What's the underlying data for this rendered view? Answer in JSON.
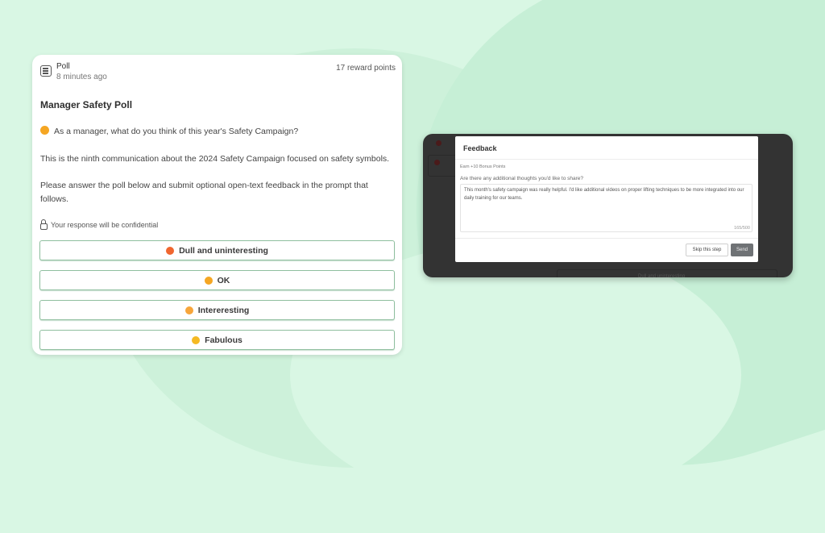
{
  "poll_card": {
    "type_label": "Poll",
    "time_ago": "8 minutes ago",
    "reward": "17 reward points",
    "title": "Manager Safety Poll",
    "question": "As a manager, what do you think of this year's Safety Campaign?",
    "body_1": "This is the ninth communication about the 2024 Safety Campaign focused on safety symbols.",
    "body_2": "Please answer the poll below and submit optional open-text feedback in the prompt that follows.",
    "confidential": "Your response will be confidential",
    "options": [
      {
        "label": "Dull and uninteresting",
        "emoji": "face-with-open-mouth-emoji",
        "color": "#f0662f"
      },
      {
        "label": "OK",
        "emoji": "tired-face-emoji",
        "color": "#f5a623"
      },
      {
        "label": "Intereresting",
        "emoji": "grinning-face-emoji",
        "color": "#f7a53b"
      },
      {
        "label": "Fabulous",
        "emoji": "raising-hands-emoji",
        "color": "#f5b923"
      }
    ]
  },
  "feedback_modal": {
    "title": "Feedback",
    "bonus": "Earn +10 Bonus Points",
    "question": "Are there any additional thoughts you'd like to share?",
    "response": "This month's safety campaign was really helpful. I'd like additional videos on proper lifting techniques to be more integrated into our daily training for our teams.",
    "char_count": "165/500",
    "skip_label": "Skip this step",
    "send_label": "Send"
  },
  "background_behind_modal": {
    "option_label": "Dull and uninteresting"
  },
  "colors": {
    "page_bg": "#d9f7e4",
    "option_border": "#8fbf9f",
    "overlay": "#333333",
    "send_button": "#6f7275"
  }
}
